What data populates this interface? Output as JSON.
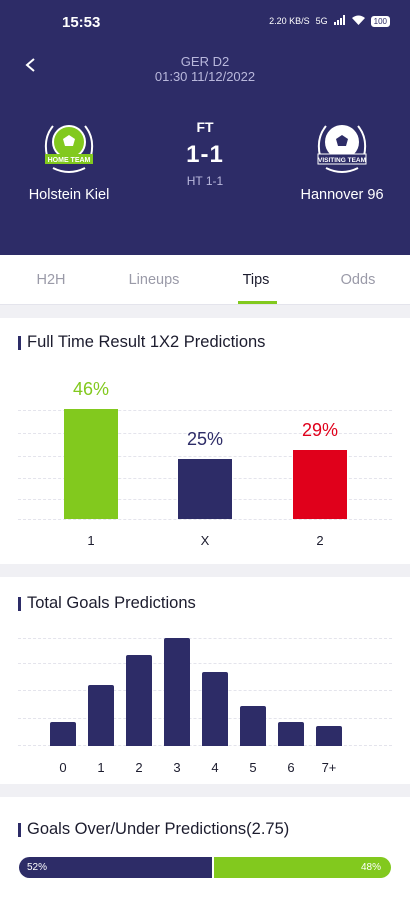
{
  "status_bar": {
    "time": "15:53",
    "speed": "2.20 KB/S",
    "network": "5G",
    "battery": "100",
    "icons": [
      "data-speed-icon",
      "signal-icon",
      "wifi-icon",
      "battery-icon"
    ]
  },
  "match": {
    "league": "GER D2",
    "datetime": "01:30 11/12/2022",
    "status": "FT",
    "score": "1-1",
    "halftime": "HT 1-1",
    "home_team": "Holstein Kiel",
    "away_team": "Hannover 96",
    "home_badge_text": "HOME TEAM",
    "away_badge_text": "VISITING TEAM"
  },
  "tabs": [
    {
      "label": "H2H",
      "active": false
    },
    {
      "label": "Lineups",
      "active": false
    },
    {
      "label": "Tips",
      "active": true
    },
    {
      "label": "Odds",
      "active": false
    }
  ],
  "result_predictions": {
    "title": "Full Time Result 1X2 Predictions",
    "items": [
      {
        "category": "1",
        "label": "46%",
        "value": 46,
        "color": "#82c91e"
      },
      {
        "category": "X",
        "label": "25%",
        "value": 25,
        "color": "#2d2c67"
      },
      {
        "category": "2",
        "label": "29%",
        "value": 29,
        "color": "#e0001b"
      }
    ]
  },
  "goals_predictions": {
    "title": "Total Goals Predictions",
    "chart_data": {
      "type": "bar",
      "categories": [
        "0",
        "1",
        "2",
        "3",
        "4",
        "5",
        "6",
        "7+"
      ],
      "values": [
        3.5,
        9.0,
        13.5,
        16.0,
        11.0,
        6.0,
        3.5,
        3.0
      ],
      "ylim": [
        0,
        16
      ],
      "grid": true
    }
  },
  "over_under": {
    "title": "Goals Over/Under Predictions(2.75)",
    "under_label": "52%",
    "over_label": "48%",
    "under_value": 52,
    "over_value": 48,
    "colors": {
      "under": "#2d2c67",
      "over": "#82c91e"
    }
  },
  "colors": {
    "primary": "#2d2c67",
    "accent": "#82c91e",
    "danger": "#e0001b"
  }
}
